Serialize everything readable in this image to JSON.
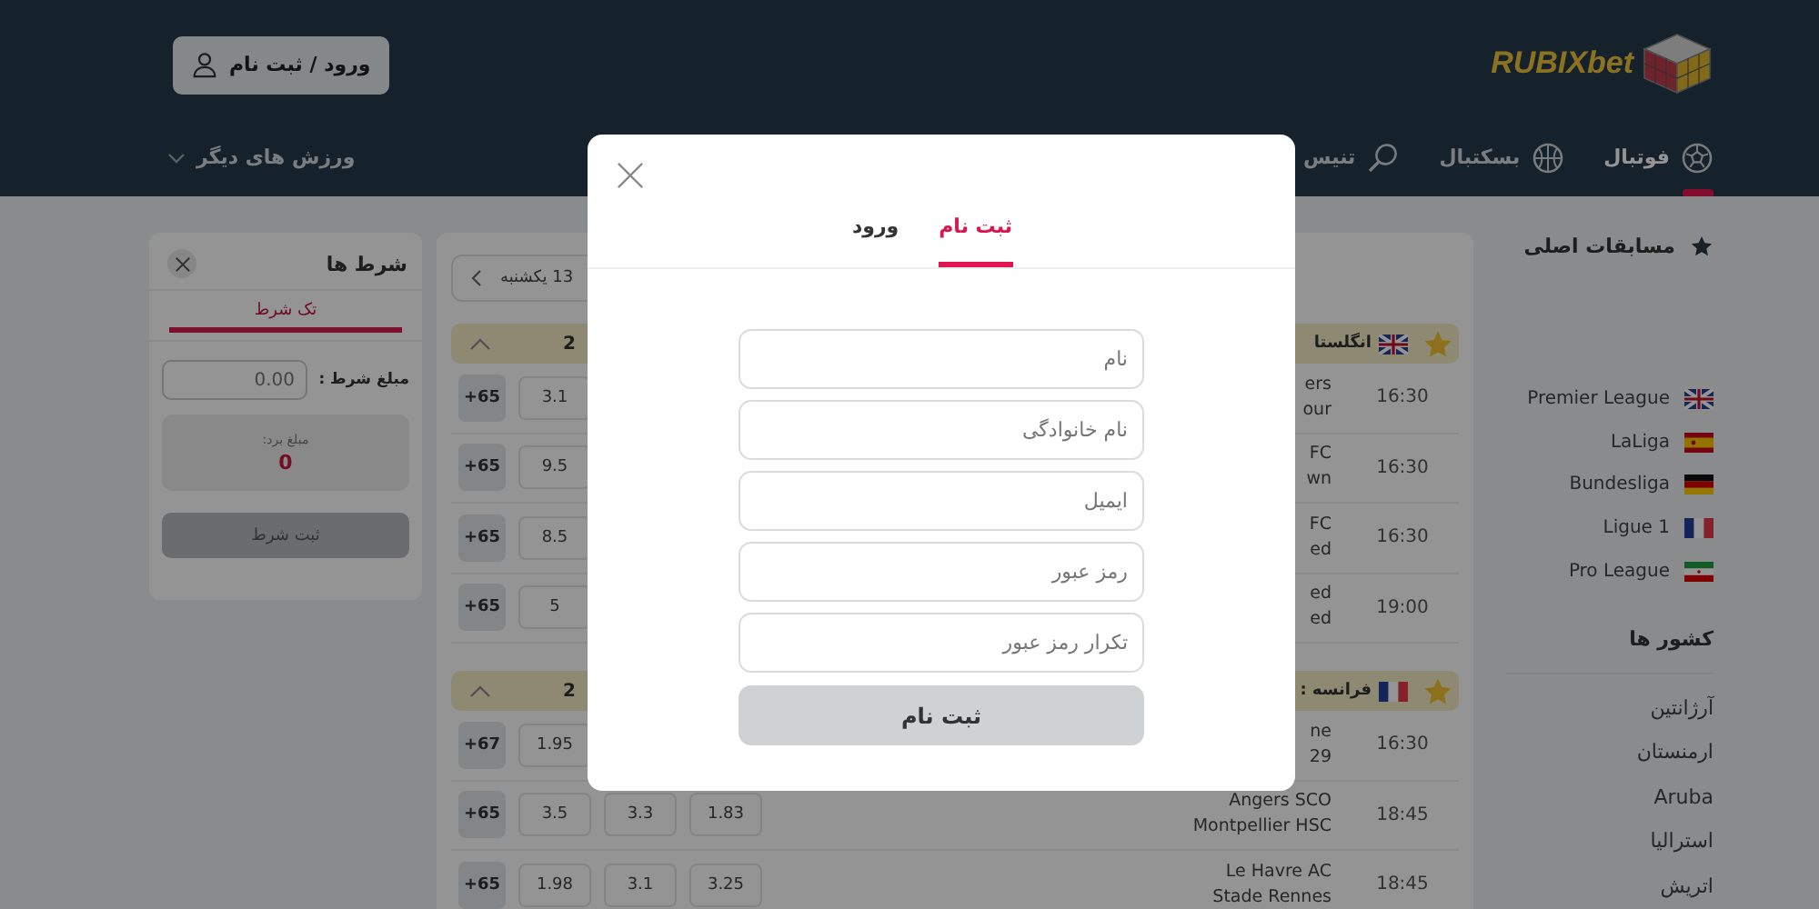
{
  "header": {
    "logo": "RUBIXbet",
    "login_button": "ورود / ثبت نام"
  },
  "nav": [
    {
      "label": "فوتبال",
      "selected": true
    },
    {
      "label": "بسکتبال",
      "selected": false
    },
    {
      "label": "تنیس",
      "selected": false
    }
  ],
  "nav_more": "ورزش های دیگر",
  "bet_slip": {
    "title": "شرط ها",
    "tab": "تک شرط",
    "stake_label": "مبلغ شرط :",
    "stake_placeholder": "0.00",
    "win_label": "مبلغ برد:",
    "win_amount": "0",
    "submit": "ثبت شرط"
  },
  "matches": {
    "date": "13 یکشنبه",
    "groups": [
      {
        "country": "انگلستا",
        "column_label": "2",
        "rows": [
          {
            "time": "16:30",
            "home": "ers",
            "away": "our",
            "more": "+65",
            "odds": [
              "3.1"
            ]
          },
          {
            "time": "16:30",
            "home": "FC",
            "away": "wn",
            "more": "+65",
            "odds": [
              "9.5"
            ]
          },
          {
            "time": "16:30",
            "home": "FC",
            "away": "ed",
            "more": "+65",
            "odds": [
              "8.5"
            ]
          },
          {
            "time": "19:00",
            "home": "ed",
            "away": "ed",
            "more": "+65",
            "odds": [
              "5"
            ]
          }
        ]
      },
      {
        "country": "فرانسه :",
        "column_label": "2",
        "rows": [
          {
            "time": "16:30",
            "home": "ne",
            "away": "29",
            "more": "+67",
            "odds": [
              "1.95"
            ]
          },
          {
            "time": "18:45",
            "home": "Angers SCO",
            "away": "Montpellier HSC",
            "more": "+65",
            "odds": [
              "1.83",
              "3.3",
              "3.5"
            ]
          },
          {
            "time": "18:45",
            "home": "Le Havre AC",
            "away": "Stade Rennes",
            "more": "+65",
            "odds": [
              "3.25",
              "3.1",
              "1.98"
            ]
          }
        ]
      }
    ]
  },
  "sidebar": {
    "title": "مسابقات اصلی",
    "leagues": [
      "Premier League",
      "LaLiga",
      "Bundesliga",
      "Ligue 1",
      "Pro League"
    ],
    "countries_title": "کشور ها",
    "countries": [
      "آرژانتین",
      "ارمنستان",
      "Aruba",
      "استرالیا",
      "اتریش"
    ]
  },
  "modal": {
    "tabs": [
      {
        "label": "ثبت نام",
        "selected": true
      },
      {
        "label": "ورود",
        "selected": false
      }
    ],
    "fields": [
      {
        "placeholder": "نام"
      },
      {
        "placeholder": "نام خانوادگی"
      },
      {
        "placeholder": "ایمیل"
      },
      {
        "placeholder": "رمز عبور"
      },
      {
        "placeholder": "تکرار رمز عبور"
      }
    ],
    "submit": "ثبت نام"
  }
}
